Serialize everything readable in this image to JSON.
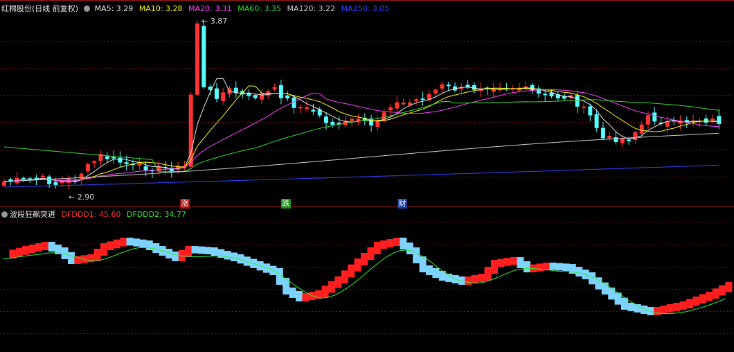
{
  "header": {
    "title": "红棉股份(日线 前复权)",
    "ma": [
      {
        "label": "MA5: 3.29",
        "color": "#e8e8e8"
      },
      {
        "label": "MA10: 3.28",
        "color": "#ffff00"
      },
      {
        "label": "MA20: 3.31",
        "color": "#ff44ff"
      },
      {
        "label": "MA60: 3.35",
        "color": "#33dd33"
      },
      {
        "label": "MA120: 3.22",
        "color": "#cccccc"
      },
      {
        "label": "MA250: 3.05",
        "color": "#3344ff"
      }
    ]
  },
  "events": [
    {
      "text": "涨",
      "bg": "#b01010"
    },
    {
      "text": "跌",
      "bg": "#1a8a1a"
    },
    {
      "text": "财",
      "bg": "#1a3fa0"
    }
  ],
  "indicator": {
    "name": "波段狂飙突进",
    "items": [
      {
        "label": "DFDDD1: 45.60",
        "color": "#ff3030"
      },
      {
        "label": "DFDDD2: 34.77",
        "color": "#33ee33"
      }
    ]
  },
  "chart_data": [
    {
      "type": "candlestick",
      "title": "红棉股份(日线 前复权)",
      "annotations": [
        {
          "text": "3.87",
          "value": 3.87,
          "marks": "high"
        },
        {
          "text": "2.90",
          "value": 2.9,
          "marks": "low"
        }
      ],
      "colors": {
        "up": "#ff3333",
        "down": "#54ffff",
        "grid": "#7a1010"
      }
    },
    {
      "type": "area",
      "title": "波段狂飙突进",
      "series": [
        {
          "name": "DFDDD1"
        },
        {
          "name": "DFDDD2"
        }
      ],
      "last": {
        "DFDDD1": 45.6,
        "DFDDD2": 34.77
      }
    }
  ]
}
